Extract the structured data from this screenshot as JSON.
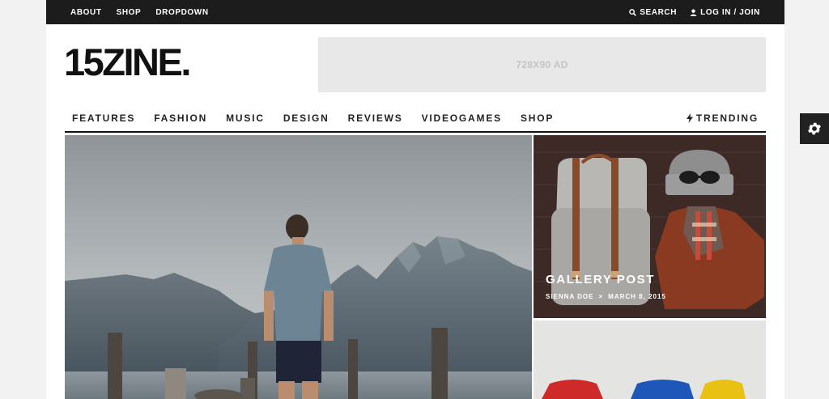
{
  "topbar": {
    "links": [
      "ABOUT",
      "SHOP",
      "DROPDOWN"
    ],
    "search_label": "SEARCH",
    "login_label": "LOG IN / JOIN"
  },
  "logo": {
    "text": "15ZINE."
  },
  "ad": {
    "text": "728X90 AD"
  },
  "nav": {
    "items": [
      "FEATURES",
      "FASHION",
      "MUSIC",
      "DESIGN",
      "REVIEWS",
      "VIDEOGAMES",
      "SHOP"
    ],
    "trending_label": "TRENDING"
  },
  "posts": {
    "side1": {
      "title": "GALLERY POST",
      "author": "SIENNA DOE",
      "separator": "×",
      "date": "MARCH 8, 2015"
    }
  },
  "colors": {
    "topbar": "#1c1c1c",
    "accent": "#111111",
    "ad_bg": "#e8e8e8"
  },
  "icons": {
    "search": "search-icon",
    "user": "user-icon",
    "trending": "bolt-icon",
    "settings": "gear-icon"
  }
}
